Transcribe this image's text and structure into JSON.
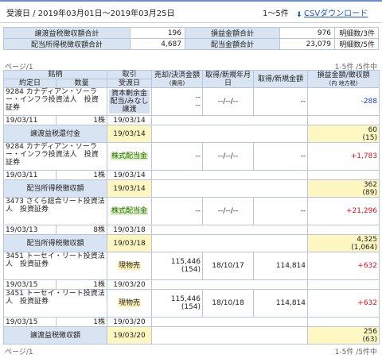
{
  "header": {
    "range": "受渡日 / 2019年03月01日〜2019年03月25日",
    "count": "1〜5件",
    "csv_label": "CSVダウンロード"
  },
  "summary": {
    "rows": [
      {
        "l1": "譲渡益税徴収額合計",
        "v1": "196",
        "l2": "損益金額合計",
        "v2": "976",
        "l3": "明細数/3件"
      },
      {
        "l1": "配当所得税徴収額合計",
        "v1": "4,687",
        "l2": "配当金額合計",
        "v2": "23,079",
        "l3": "明細数/5件"
      }
    ]
  },
  "pager": {
    "left": "ページ/1",
    "right": "1-5件 /5件中"
  },
  "table": {
    "h_meigara": "銘柄",
    "h_torihiki": "取引",
    "h_baikyaku": "売却/決済金額",
    "h_baikyaku_sub": "(費用)",
    "h_shutoku": "取得/新規年月日",
    "h_shinki": "取得/新規金額",
    "h_soneki": "損益金額/徴収額",
    "h_soneki_sub": "(内 地方税)",
    "h_yakujo": "約定日",
    "h_suryo": "数量",
    "h_ukewatashi": "受渡日",
    "r1": {
      "name": "9284 カナディアン・ソーラー・インフラ投資法人　投資証券",
      "kind": "資本剰余金配当/みなし譲渡",
      "amt": "--",
      "amt2": "--",
      "date": "--/--/--",
      "samt": "--",
      "pl": "-288",
      "yakujo": "19/03/11",
      "qty": "1株",
      "uke": "19/03/14"
    },
    "r1b": {
      "label": "譲渡益税還付金",
      "uke": "19/03/14",
      "v": "60",
      "v2": "(15)"
    },
    "r2": {
      "name": "9284 カナディアン・ソーラー・インフラ投資法人　投資証券",
      "kind": "株式配当金",
      "amt": "--",
      "date": "--/--/--",
      "samt": "--",
      "pl": "+1,783",
      "yakujo": "19/03/11",
      "qty": "1株",
      "uke": "19/03/14"
    },
    "r2b": {
      "label": "配当所得税徴収額",
      "uke": "19/03/14",
      "v": "362",
      "v2": "(89)"
    },
    "r3": {
      "name": "3473 さくら総合リート投資法人　投資証券",
      "kind": "株式配当金",
      "amt": "--",
      "date": "--/--/--",
      "samt": "--",
      "pl": "+21,296",
      "yakujo": "19/03/13",
      "qty": "8株",
      "uke": "19/03/18"
    },
    "r3b": {
      "label": "配当所得税徴収額",
      "uke": "19/03/18",
      "v": "4,325",
      "v2": "(1,064)"
    },
    "r4": {
      "name": "3451 トーセイ・リート投資法人　投資証券",
      "kind": "現物売",
      "amt": "115,446",
      "amt2": "(154)",
      "date": "18/10/17",
      "samt": "114,814",
      "pl": "+632",
      "yakujo": "19/03/15",
      "qty": "1株",
      "uke": "19/03/20"
    },
    "r5": {
      "name": "3451 トーセイ・リート投資法人　投資証券",
      "kind": "現物売",
      "amt": "115,446",
      "amt2": "(154)",
      "date": "18/10/18",
      "samt": "114,814",
      "pl": "+632",
      "yakujo": "19/03/15",
      "qty": "1株",
      "uke": "19/03/20"
    },
    "r5b": {
      "label": "譲渡益税徴収額",
      "uke": "19/03/20",
      "v": "256",
      "v2": "(63)"
    }
  }
}
